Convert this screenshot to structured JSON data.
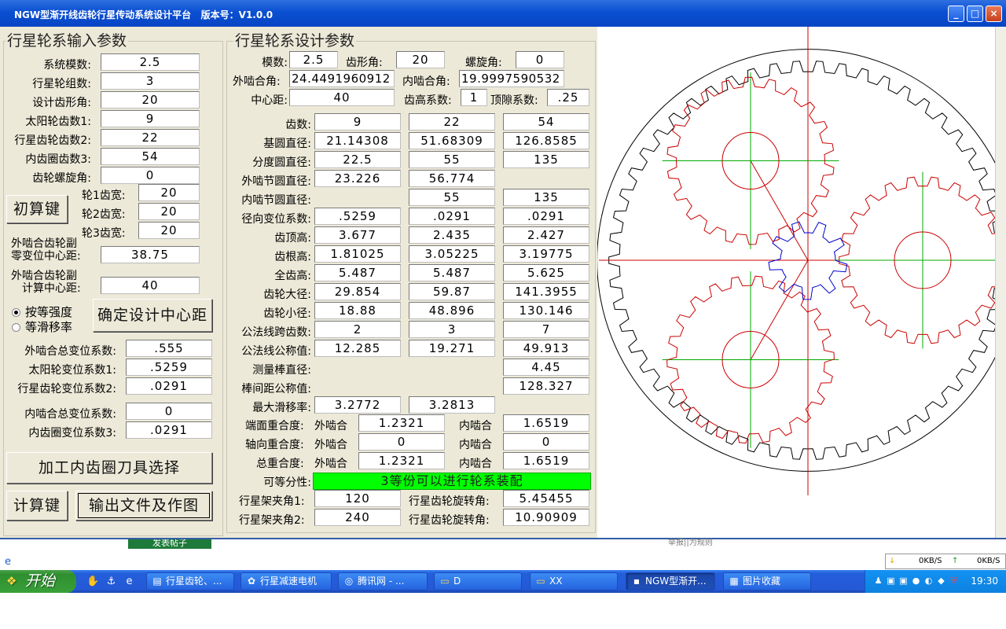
{
  "window": {
    "title": "NGW型渐开线齿轮行星传动系统设计平台   版本号：V1.0.0"
  },
  "input": {
    "title": "行星轮系输入参数",
    "rows": [
      {
        "label": "系统模数:",
        "value": "2.5"
      },
      {
        "label": "行星轮组数:",
        "value": "3"
      },
      {
        "label": "设计齿形角:",
        "value": "20"
      },
      {
        "label": "太阳轮齿数1:",
        "value": "9"
      },
      {
        "label": "行星齿轮齿数2:",
        "value": "22"
      },
      {
        "label": "内齿圈齿数3:",
        "value": "54"
      },
      {
        "label": "齿轮螺旋角:",
        "value": "0"
      }
    ],
    "init_button": "初算键",
    "widths": [
      {
        "label": "轮1齿宽:",
        "value": "20"
      },
      {
        "label": "轮2齿宽:",
        "value": "20"
      },
      {
        "label": "轮3齿宽:",
        "value": "20"
      }
    ],
    "zero_center_label1": "外啮合齿轮副",
    "zero_center_label2": "零变位中心距:",
    "zero_center_value": "38.75",
    "calc_center_label1": "外啮合齿轮副",
    "calc_center_label2": "计算中心距:",
    "calc_center_value": "40",
    "radio1": "按等强度",
    "radio2": "等滑移率",
    "confirm_button": "确定设计中心距",
    "ext_total_label": "外啮合总变位系数:",
    "ext_total_value": ".555",
    "sun_shift_label": "太阳轮变位系数1:",
    "sun_shift_value": ".5259",
    "planet_shift_label": "行星齿轮变位系数2:",
    "planet_shift_value": ".0291",
    "int_total_label": "内啮合总变位系数:",
    "int_total_value": "0",
    "ring_shift_label": "内齿圈变位系数3:",
    "ring_shift_value": ".0291",
    "tool_button": "加工内齿圈刀具选择",
    "calc_button": "计算键",
    "output_button": "输出文件及作图"
  },
  "design": {
    "title": "行星轮系设计参数",
    "module_label": "模数:",
    "module_value": "2.5",
    "pressure_label": "齿形角:",
    "pressure_value": "20",
    "helix_label": "螺旋角:",
    "helix_value": "0",
    "ext_angle_label": "外啮合角:",
    "ext_angle_value": "24.4491960912",
    "int_angle_label": "内啮合角:",
    "int_angle_value": "19.9997590532",
    "center_label": "中心距:",
    "center_value": "40",
    "addendum_coef_label": "齿高系数:",
    "addendum_coef_value": "1",
    "clearance_label": "顶隙系数:",
    "clearance_value": ".25",
    "table": [
      {
        "label": "齿数:",
        "values": [
          "9",
          "22",
          "54"
        ]
      },
      {
        "label": "基圆直径:",
        "values": [
          "21.14308",
          "51.68309",
          "126.8585"
        ]
      },
      {
        "label": "分度圆直径:",
        "values": [
          "22.5",
          "55",
          "135"
        ]
      },
      {
        "label": "外啮节圆直径:",
        "values": [
          "23.226",
          "56.774",
          ""
        ]
      },
      {
        "label": "内啮节圆直径:",
        "values": [
          "",
          "55",
          "135"
        ]
      },
      {
        "label": "径向变位系数:",
        "values": [
          ".5259",
          ".0291",
          ".0291"
        ]
      },
      {
        "label": "齿顶高:",
        "values": [
          "3.677",
          "2.435",
          "2.427"
        ]
      },
      {
        "label": "齿根高:",
        "values": [
          "1.81025",
          "3.05225",
          "3.19775"
        ]
      },
      {
        "label": "全齿高:",
        "values": [
          "5.487",
          "5.487",
          "5.625"
        ]
      },
      {
        "label": "齿轮大径:",
        "values": [
          "29.854",
          "59.87",
          "141.3955"
        ]
      },
      {
        "label": "齿轮小径:",
        "values": [
          "18.88",
          "48.896",
          "130.146"
        ]
      },
      {
        "label": "公法线跨齿数:",
        "values": [
          "2",
          "3",
          "7"
        ]
      },
      {
        "label": "公法线公称值:",
        "values": [
          "12.285",
          "19.271",
          "49.913"
        ]
      },
      {
        "label": "测量棒直径:",
        "values": [
          "",
          "",
          "4.45"
        ]
      },
      {
        "label": "棒间距公称值:",
        "values": [
          "",
          "",
          "128.327"
        ]
      },
      {
        "label": "最大滑移率:",
        "values": [
          "3.2772",
          "3.2813",
          ""
        ]
      }
    ],
    "end_contact_label": "端面重合度:",
    "axial_contact_label": "轴向重合度:",
    "total_contact_label": "总重合度:",
    "ext_word": "外啮合",
    "int_word": "内啮合",
    "end_ext": "1.2321",
    "end_int": "1.6519",
    "axial_ext": "0",
    "axial_int": "0",
    "total_ext": "1.2321",
    "total_int": "1.6519",
    "divisible_label": "可等分性:",
    "divisible_value": "3等份可以进行轮系装配",
    "carrier1_label": "行星架夹角1:",
    "carrier1_value": "120",
    "carrier2_label": "行星架夹角2:",
    "carrier2_value": "240",
    "rot1_label": "行星齿轮旋转角:",
    "rot1_value": "5.45455",
    "rot2_label": "行星齿轮旋转角:",
    "rot2_value": "10.90909"
  },
  "drawing": {
    "sun_teeth": 9,
    "planet_teeth": 22,
    "ring_teeth": 54,
    "planet_count": 3,
    "colors": {
      "sun": "#0000cc",
      "planet": "#cc0000",
      "ring": "#000000",
      "center_line": "#cc0000",
      "axis": "#00aa00",
      "ok_green": "#00ff00"
    }
  },
  "status": {
    "tag_text": "发表帖子",
    "tag_right": "举报||为规则",
    "net_down": "0KB/S",
    "net_up": "0KB/S"
  },
  "taskbar": {
    "start": "开始",
    "tasks": [
      "行星齿轮、...",
      "行星减速电机",
      "腾讯网 - ...",
      "D",
      "XX",
      "NGW型渐开...",
      "图片收藏"
    ],
    "clock": "19:30"
  }
}
